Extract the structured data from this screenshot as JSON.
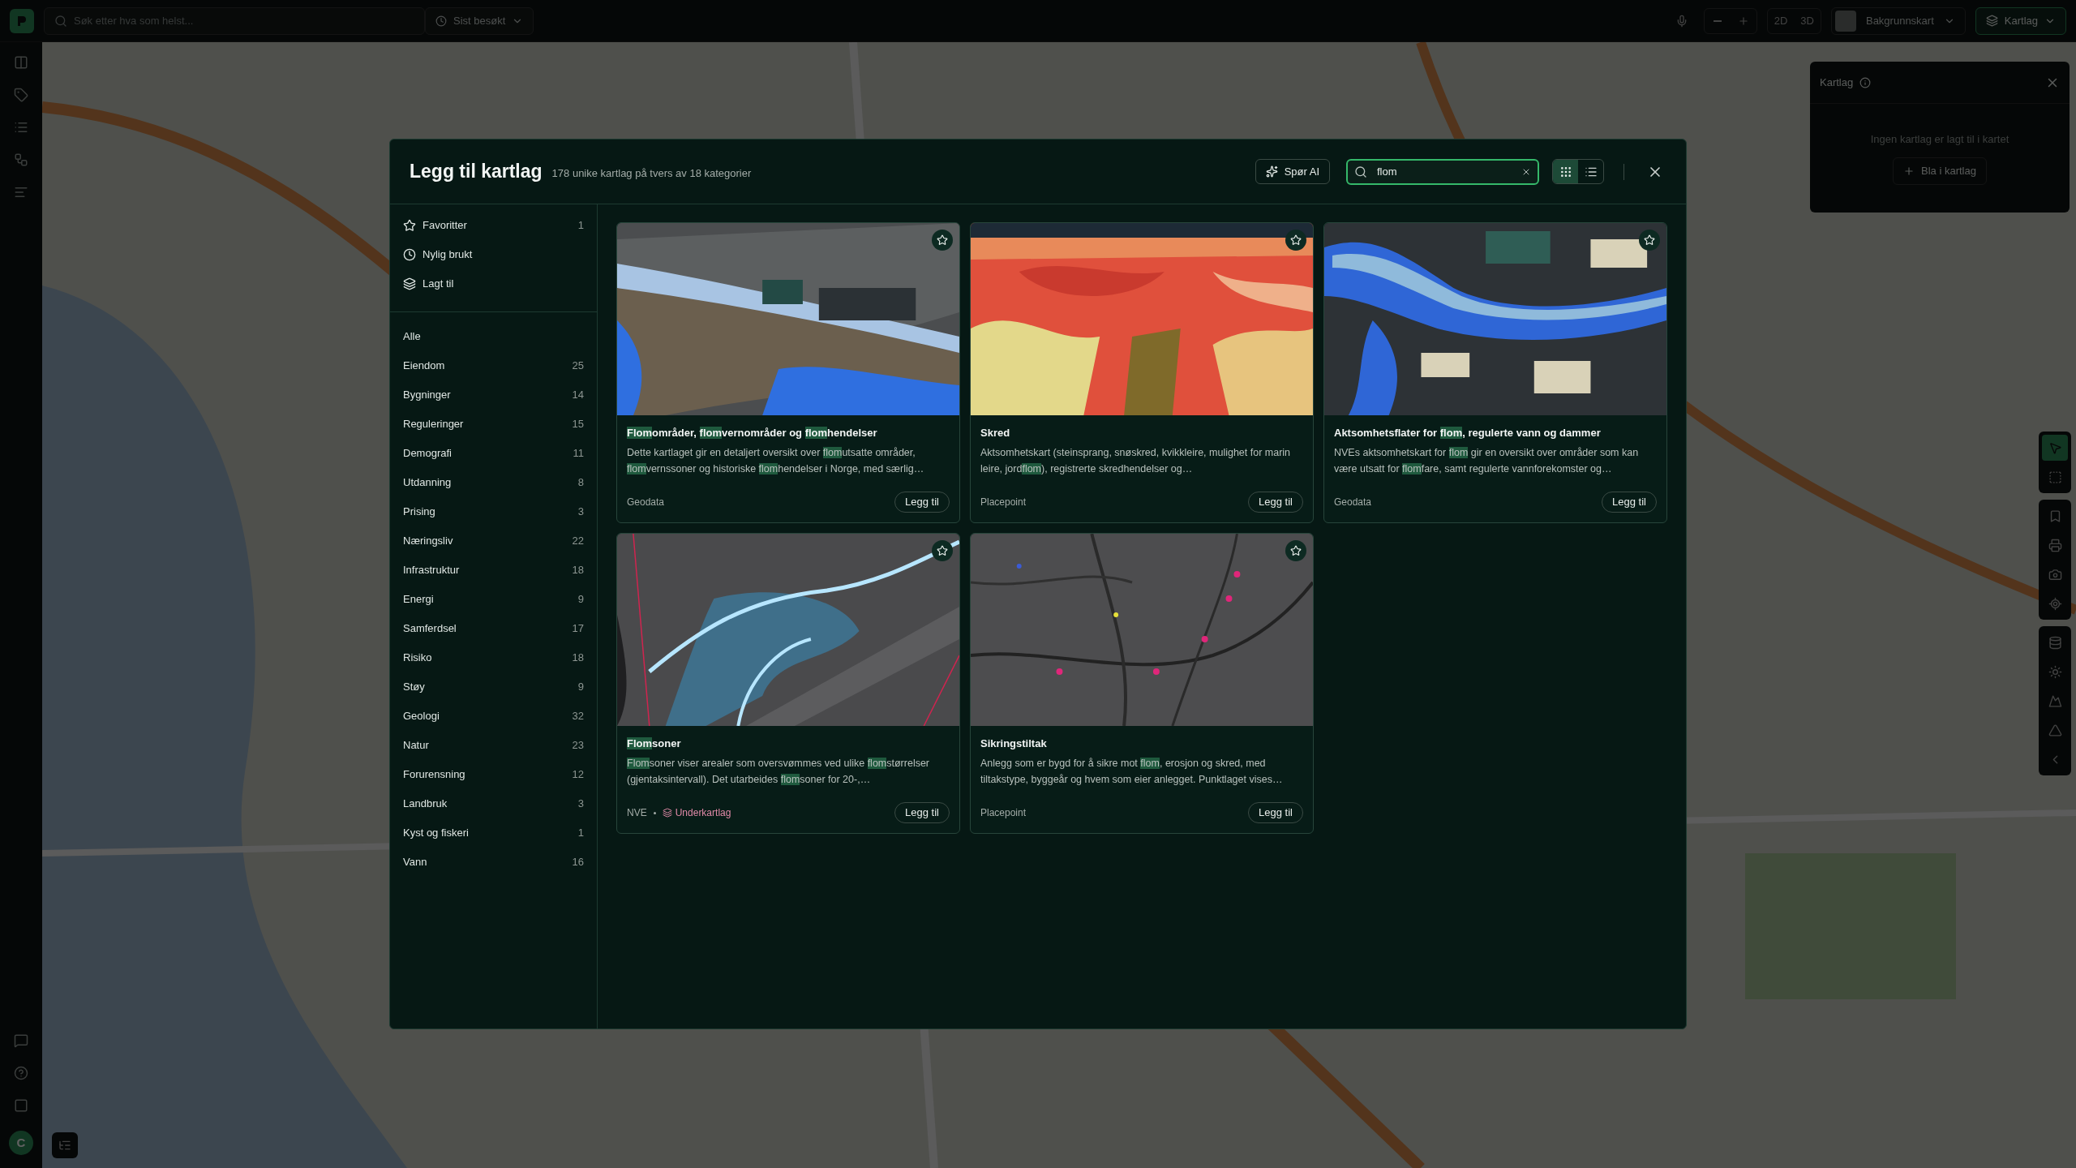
{
  "top_bar": {
    "search_placeholder": "Søk etter hva som helst...",
    "recent_button": "Sist besøkt",
    "view_modes": [
      "2D",
      "3D"
    ],
    "basemap_button": "Bakgrunnskart",
    "layers_button": {
      "label": "Kartlag",
      "active": true
    }
  },
  "avatar": {
    "initial": "C"
  },
  "layers_panel": {
    "title": "Kartlag",
    "empty_text": "Ingen kartlag er lagt til i kartet",
    "browse_button": "Bla i kartlag"
  },
  "map_tools": [
    {
      "kind": "pointer",
      "selected": true
    },
    {
      "kind": "select",
      "selected": false
    },
    {
      "kind": "bookmark",
      "selected": false
    },
    {
      "kind": "print",
      "selected": false
    },
    {
      "kind": "camera",
      "selected": false
    },
    {
      "kind": "locate",
      "selected": false
    },
    {
      "kind": "measure",
      "selected": false
    },
    {
      "kind": "light",
      "selected": false
    },
    {
      "kind": "terrain",
      "selected": false
    },
    {
      "kind": "triangle",
      "selected": false
    },
    {
      "kind": "collapse",
      "selected": false
    }
  ],
  "dialog": {
    "title": "Legg til kartlag",
    "subtitle": "178 unike kartlag på tvers av 18 kategorier",
    "ai_button": "Spør AI",
    "search": {
      "value": "flom"
    },
    "view_toggle": [
      {
        "kind": "grid",
        "selected": true
      },
      {
        "kind": "list",
        "selected": false
      }
    ],
    "quick_filters": [
      {
        "kind": "favorites",
        "label": "Favoritter",
        "count": "1"
      },
      {
        "kind": "recent",
        "label": "Nylig brukt"
      },
      {
        "kind": "added",
        "label": "Lagt til"
      }
    ],
    "categories": [
      {
        "label": "Alle"
      },
      {
        "label": "Eiendom",
        "count": "25"
      },
      {
        "label": "Bygninger",
        "count": "14"
      },
      {
        "label": "Reguleringer",
        "count": "15"
      },
      {
        "label": "Demografi",
        "count": "11"
      },
      {
        "label": "Utdanning",
        "count": "8"
      },
      {
        "label": "Prising",
        "count": "3"
      },
      {
        "label": "Næringsliv",
        "count": "22"
      },
      {
        "label": "Infrastruktur",
        "count": "18"
      },
      {
        "label": "Energi",
        "count": "9"
      },
      {
        "label": "Samferdsel",
        "count": "17"
      },
      {
        "label": "Risiko",
        "count": "18"
      },
      {
        "label": "Støy",
        "count": "9"
      },
      {
        "label": "Geologi",
        "count": "32"
      },
      {
        "label": "Natur",
        "count": "23"
      },
      {
        "label": "Forurensning",
        "count": "12"
      },
      {
        "label": "Landbruk",
        "count": "3"
      },
      {
        "label": "Kyst og fiskeri",
        "count": "1"
      },
      {
        "label": "Vann",
        "count": "16"
      }
    ],
    "cards": [
      {
        "title": "**Flom**områder, **flom**vernområder og **flom**hendelser",
        "description": "Dette kartlaget gir en detaljert oversikt over **flom**utsatte områder, **flom**vernssoner og historiske **flom**hendelser i Norge, med særlig…",
        "source": "Geodata",
        "button": "Legg til",
        "favorite": false
      },
      {
        "title": "Skred",
        "description": "Aktsomhetskart (steinsprang, snøskred, kvikkleire, mulighet for marin leire, jord**flom**), registrerte skredhendelser og…",
        "source": "Placepoint",
        "button": "Legg til",
        "favorite": false
      },
      {
        "title": "Aktsomhetsflater for **flom**, regulerte vann og dammer",
        "description": "NVEs aktsomhetskart for **flom** gir en oversikt over områder som kan være utsatt for **flom**fare, samt regulerte vannforekomster og…",
        "source": "Geodata",
        "button": "Legg til",
        "favorite": false
      },
      {
        "title": "**Flom**soner",
        "description": "**Flom**soner viser arealer som oversvømmes ved ulike **flom**størrelser (gjentaksintervall). Det utarbeides **flom**soner for 20-,…",
        "source": "NVE",
        "badge": "Underkartlag",
        "button": "Legg til",
        "favorite": false
      },
      {
        "title": "Sikringstiltak",
        "description": "Anlegg som er bygd for å sikre mot **flom**, erosjon og skred, med tiltakstype, byggeår og hvem som eier anlegget. Punktlaget vises…",
        "source": "Placepoint",
        "button": "Legg til",
        "favorite": false
      }
    ]
  }
}
